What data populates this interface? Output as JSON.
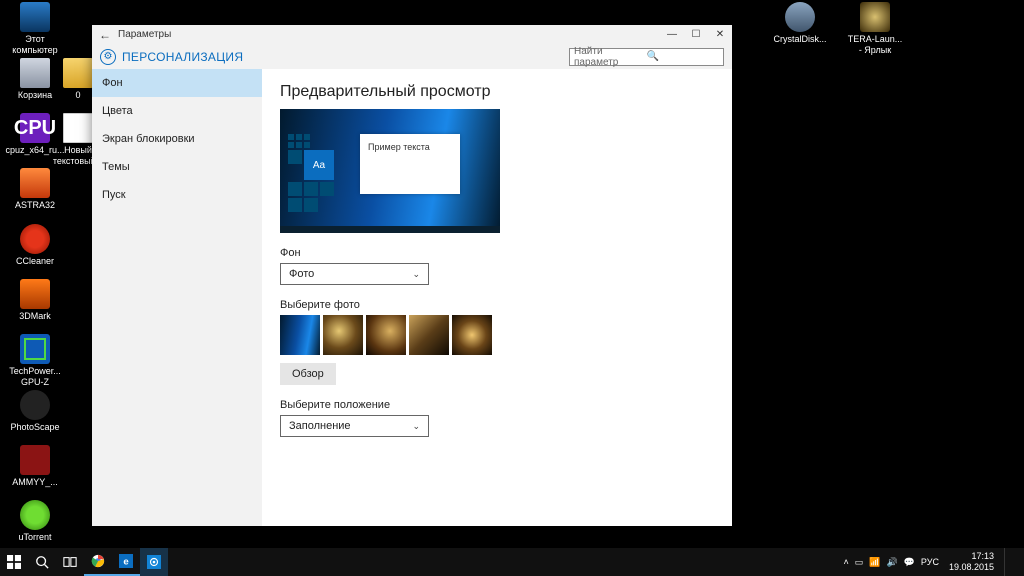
{
  "desktop": {
    "icons_left": [
      {
        "label": "Этот компьютер"
      },
      {
        "label": "Корзина"
      },
      {
        "label": "cpuz_x64_ru..."
      },
      {
        "label": "ASTRA32"
      },
      {
        "label": "CCleaner"
      },
      {
        "label": "3DMark"
      },
      {
        "label": "TechPower... GPU-Z"
      },
      {
        "label": "PhotoScape"
      },
      {
        "label": "AMMYY_..."
      },
      {
        "label": "uTorrent"
      }
    ],
    "icons_col2": [
      {
        "label": "0"
      },
      {
        "label": "Новый текстовый..."
      }
    ],
    "icons_right": [
      {
        "label": "CrystalDisk..."
      },
      {
        "label": "TERA-Laun... - Ярлык"
      }
    ]
  },
  "settings": {
    "title": "Параметры",
    "section": "ПЕРСОНАЛИЗАЦИЯ",
    "search_placeholder": "Найти параметр",
    "sidebar": {
      "items": [
        {
          "label": "Фон",
          "active": true
        },
        {
          "label": "Цвета"
        },
        {
          "label": "Экран блокировки"
        },
        {
          "label": "Темы"
        },
        {
          "label": "Пуск"
        }
      ]
    },
    "content": {
      "preview_title": "Предварительный просмотр",
      "preview_sample_text": "Пример текста",
      "preview_aa": "Aa",
      "bg_label": "Фон",
      "bg_value": "Фото",
      "choose_photo_label": "Выберите фото",
      "browse_label": "Обзор",
      "fit_label": "Выберите положение",
      "fit_value": "Заполнение"
    }
  },
  "taskbar": {
    "tray_lang": "РУС",
    "time": "17:13",
    "date": "19.08.2015"
  }
}
